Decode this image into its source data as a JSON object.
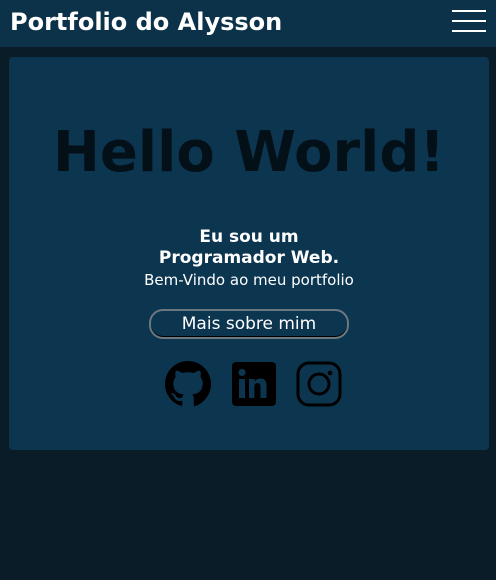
{
  "navbar": {
    "brand": "Portfolio do Alysson",
    "menu_icon": "hamburger-menu-icon"
  },
  "hero": {
    "title": "Hello World!",
    "intro_line1": "Eu sou um",
    "intro_line2": "Programador Web.",
    "welcome": "Bem-Vindo ao meu portfolio",
    "about_button": "Mais sobre mim"
  },
  "social_links": [
    {
      "icon": "github-icon"
    },
    {
      "icon": "linkedin-icon"
    },
    {
      "icon": "instagram-icon"
    }
  ],
  "colors": {
    "page_background": "#0b1c29",
    "navbar": "#0c3249",
    "card": "#0c3550",
    "title_text": "#041018",
    "text": "#ffffff"
  }
}
